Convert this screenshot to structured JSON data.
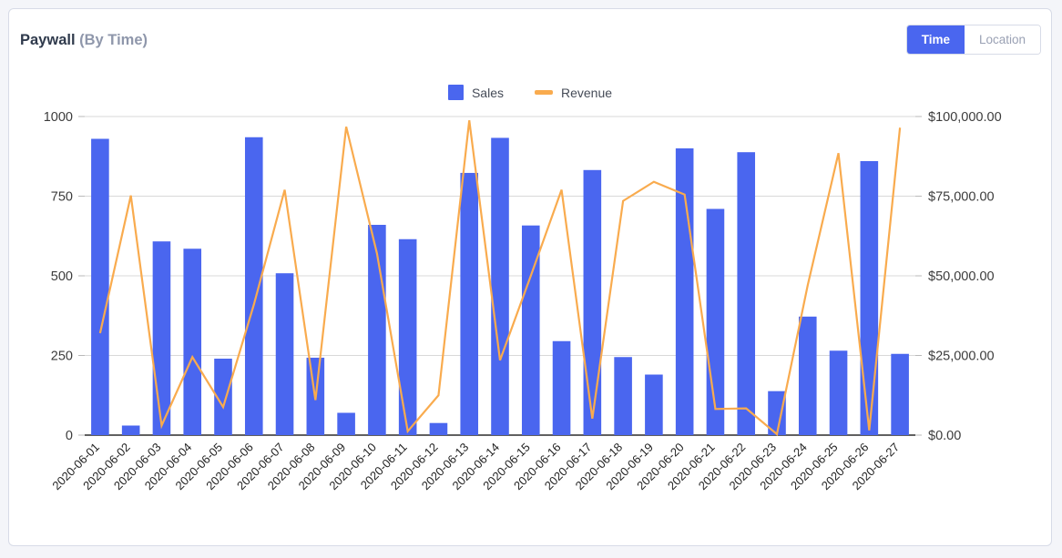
{
  "header": {
    "title_main": "Paywall",
    "title_sub": "(By Time)",
    "toggle": {
      "active": "Time",
      "inactive": "Location"
    }
  },
  "legend": {
    "sales_label": "Sales",
    "revenue_label": "Revenue",
    "sales_color": "#4a66ef",
    "revenue_color": "#f9ab4e"
  },
  "chart_data": {
    "type": "bar",
    "title": "Paywall (By Time)",
    "xlabel": "",
    "ylabel": "",
    "grid": true,
    "legend_position": "top-center",
    "categories": [
      "2020-06-01",
      "2020-06-02",
      "2020-06-03",
      "2020-06-04",
      "2020-06-05",
      "2020-06-06",
      "2020-06-07",
      "2020-06-08",
      "2020-06-09",
      "2020-06-10",
      "2020-06-11",
      "2020-06-12",
      "2020-06-13",
      "2020-06-14",
      "2020-06-15",
      "2020-06-16",
      "2020-06-17",
      "2020-06-18",
      "2020-06-19",
      "2020-06-20",
      "2020-06-21",
      "2020-06-22",
      "2020-06-23",
      "2020-06-24",
      "2020-06-25",
      "2020-06-26",
      "2020-06-27"
    ],
    "series": [
      {
        "name": "Sales",
        "type": "bar",
        "axis": "left",
        "color": "#4a66ef",
        "values": [
          930,
          30,
          608,
          585,
          240,
          935,
          508,
          243,
          70,
          660,
          615,
          38,
          823,
          933,
          658,
          295,
          832,
          245,
          190,
          900,
          710,
          888,
          138,
          372,
          265,
          860,
          255
        ]
      },
      {
        "name": "Revenue",
        "type": "line",
        "axis": "right",
        "color": "#f9ab4e",
        "values": [
          32000,
          75200,
          3000,
          24500,
          8800,
          41000,
          77000,
          11000,
          96800,
          57000,
          1200,
          12500,
          98800,
          23500,
          50000,
          77000,
          5200,
          73500,
          79500,
          75500,
          8200,
          8400,
          300,
          47000,
          88500,
          1500,
          96500
        ]
      }
    ],
    "left_axis": {
      "ticks": [
        0,
        250,
        500,
        750,
        1000
      ],
      "tick_labels": [
        "0",
        "250",
        "500",
        "750",
        "1000"
      ],
      "min": 0,
      "max": 1000
    },
    "right_axis": {
      "ticks": [
        0,
        25000,
        50000,
        75000,
        100000
      ],
      "tick_labels": [
        "$0.00",
        "$25,000.00",
        "$50,000.00",
        "$75,000.00",
        "$100,000.00"
      ],
      "min": 0,
      "max": 100000
    }
  }
}
